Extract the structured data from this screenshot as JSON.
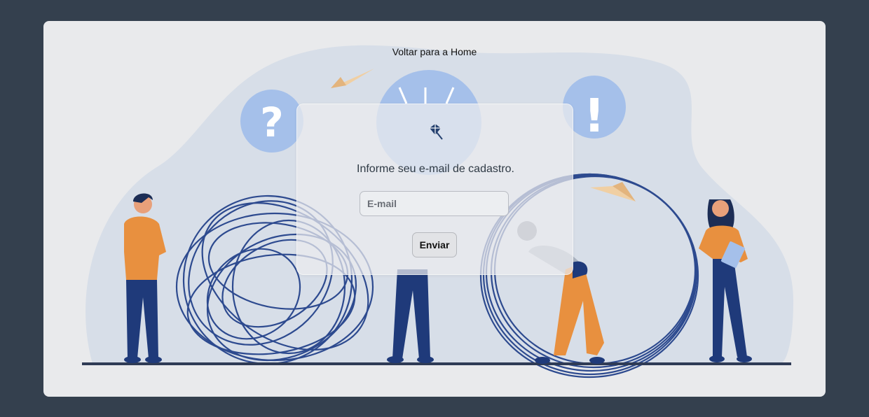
{
  "nav": {
    "home_link": "Voltar para a Home"
  },
  "form": {
    "prompt": "Informe seu e-mail de cadastro.",
    "email_placeholder": "E-mail",
    "email_value": "",
    "submit_label": "Enviar"
  },
  "illustration": {
    "question_mark": "?",
    "exclamation_mark": "!",
    "logo_icon": "diamond-arrow-icon"
  },
  "colors": {
    "page_bg": "#34404e",
    "card_bg": "#e9eaec",
    "blob": "#d7dee8",
    "accent_blue": "#a5c0ea",
    "navy": "#1f3a7a",
    "orange": "#e8903f"
  }
}
